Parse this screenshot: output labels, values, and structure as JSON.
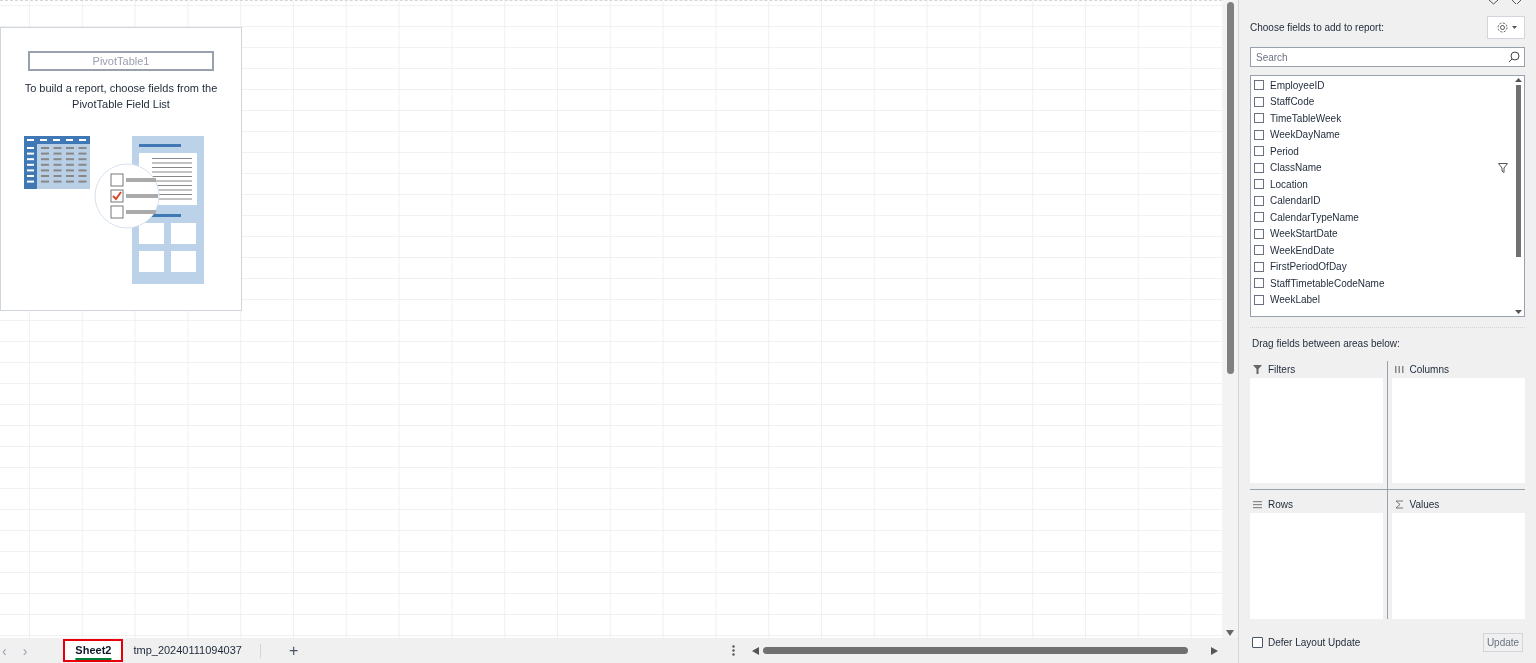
{
  "pivot_placeholder": {
    "name": "PivotTable1",
    "instructions": "To build a report, choose fields from the PivotTable Field List"
  },
  "sheet_tabs": [
    {
      "label": "Sheet2",
      "selected": true
    },
    {
      "label": "tmp_20240111094037",
      "selected": false
    }
  ],
  "sheet_nav": [
    "‹",
    "›"
  ],
  "add_sheet": "+",
  "field_pane": {
    "prompt": "Choose fields to add to report:",
    "search": {
      "placeholder": "Search"
    },
    "fields": [
      {
        "name": "EmployeeID",
        "checked": false,
        "filtered": false
      },
      {
        "name": "StaffCode",
        "checked": false,
        "filtered": false
      },
      {
        "name": "TimeTableWeek",
        "checked": false,
        "filtered": false
      },
      {
        "name": "WeekDayName",
        "checked": false,
        "filtered": false
      },
      {
        "name": "Period",
        "checked": false,
        "filtered": false
      },
      {
        "name": "ClassName",
        "checked": false,
        "filtered": true
      },
      {
        "name": "Location",
        "checked": false,
        "filtered": false
      },
      {
        "name": "CalendarID",
        "checked": false,
        "filtered": false
      },
      {
        "name": "CalendarTypeName",
        "checked": false,
        "filtered": false
      },
      {
        "name": "WeekStartDate",
        "checked": false,
        "filtered": false
      },
      {
        "name": "WeekEndDate",
        "checked": false,
        "filtered": false
      },
      {
        "name": "FirstPeriodOfDay",
        "checked": false,
        "filtered": false
      },
      {
        "name": "StaffTimetableCodeName",
        "checked": false,
        "filtered": false
      },
      {
        "name": "WeekLabel",
        "checked": false,
        "filtered": false
      }
    ],
    "areas_prompt": "Drag fields between areas below:",
    "areas": [
      {
        "kind": "filters",
        "label": "Filters"
      },
      {
        "kind": "columns",
        "label": "Columns"
      },
      {
        "kind": "rows",
        "label": "Rows"
      },
      {
        "kind": "values",
        "label": "Values"
      }
    ],
    "defer": {
      "label": "Defer Layout Update",
      "checked": false
    },
    "update_button": {
      "label": "Update",
      "disabled": true
    }
  }
}
